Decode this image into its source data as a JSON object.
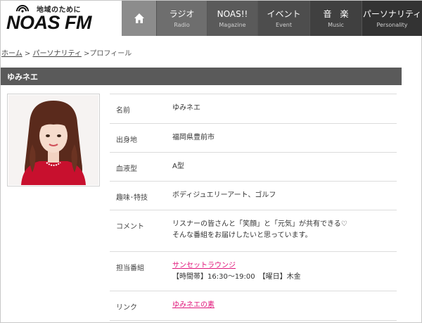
{
  "logo": {
    "tagline": "地域のために",
    "name": "NOAS FM"
  },
  "nav": {
    "home_icon": "home-icon",
    "items": [
      {
        "label": "ラジオ",
        "sub": "Radio"
      },
      {
        "label": "NOAS!!",
        "sub": "Magazine"
      },
      {
        "label": "イベント",
        "sub": "Event"
      },
      {
        "label": "音　楽",
        "sub": "Music"
      },
      {
        "label": "パーソナリティ",
        "sub": "Personality"
      }
    ]
  },
  "breadcrumb": {
    "home": "ホーム",
    "sep1": " > ",
    "personality": "パーソナリティ",
    "sep2": " >",
    "current": "プロフィール"
  },
  "title": "ゆみネエ",
  "profile": {
    "name_label": "名前",
    "name_value": "ゆみネエ",
    "hometown_label": "出身地",
    "hometown_value": "福岡県豊前市",
    "blood_label": "血液型",
    "blood_value": "A型",
    "hobby_label": "趣味･特技",
    "hobby_value": "ボディジュエリーアート、ゴルフ",
    "comment_label": "コメント",
    "comment_line1": "リスナーの皆さんと「笑顔」と「元気」が共有できる♡",
    "comment_line2": "そんな番組をお届けしたいと思っています。",
    "program_label": "担当番組",
    "program_link": "サンセットラウンジ",
    "program_schedule": "【時間帯】16:30～19:00　【曜日】木金",
    "link_label": "リンク",
    "link_value": "ゆみネエの素"
  },
  "colors": {
    "title_bar": "#5a5a5a",
    "link": "#e0157a",
    "nav_dark": "#333333"
  }
}
